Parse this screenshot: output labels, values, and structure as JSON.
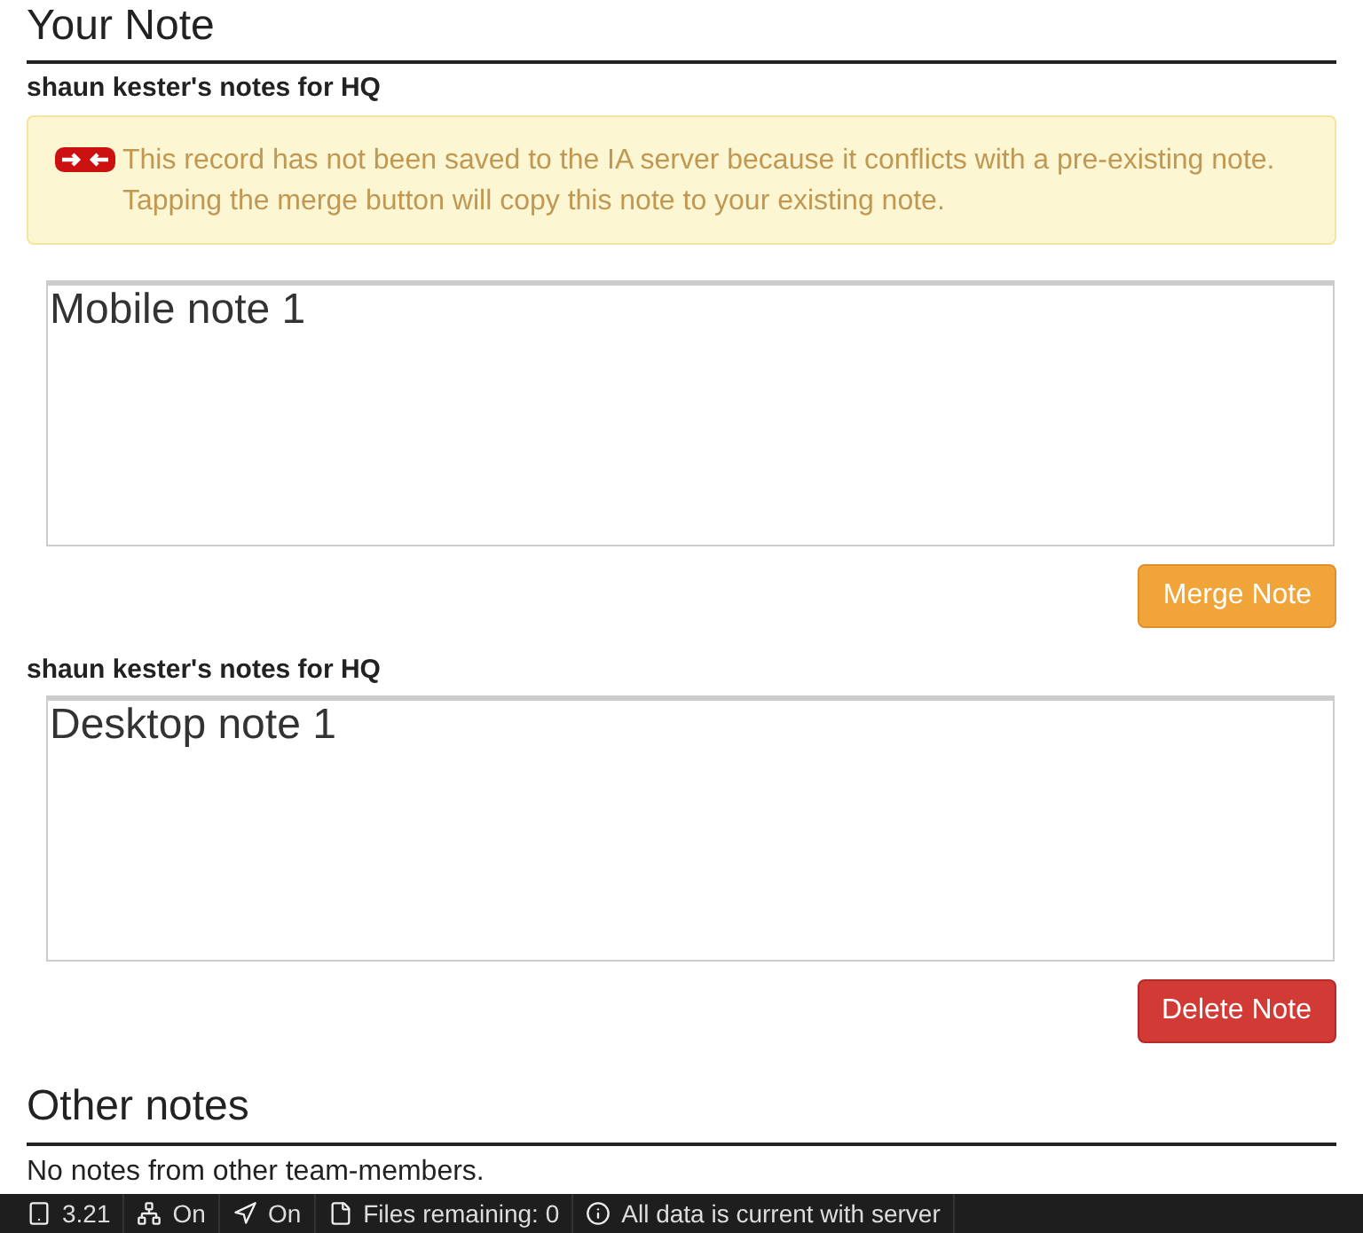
{
  "title": "Your Note",
  "notes": [
    {
      "owner": "shaun kester's notes for HQ",
      "warning": "This record has not been saved to the IA server because it conflicts with a pre-existing note. Tapping the merge button will copy this note to your existing note.",
      "value": "Mobile note 1",
      "button": {
        "label": "Merge Note",
        "kind": "merge"
      }
    },
    {
      "owner": "shaun kester's notes for HQ",
      "value": "Desktop note 1",
      "button": {
        "label": "Delete Note",
        "kind": "delete"
      }
    }
  ],
  "other_notes": {
    "title": "Other notes",
    "message": "No notes from other team-members."
  },
  "status_bar": [
    {
      "kind": "device",
      "text": "3.21"
    },
    {
      "kind": "network",
      "text": "On"
    },
    {
      "kind": "location",
      "text": "On"
    },
    {
      "kind": "file",
      "text": "Files remaining: 0"
    },
    {
      "kind": "info",
      "text": "All data is current with server"
    }
  ]
}
